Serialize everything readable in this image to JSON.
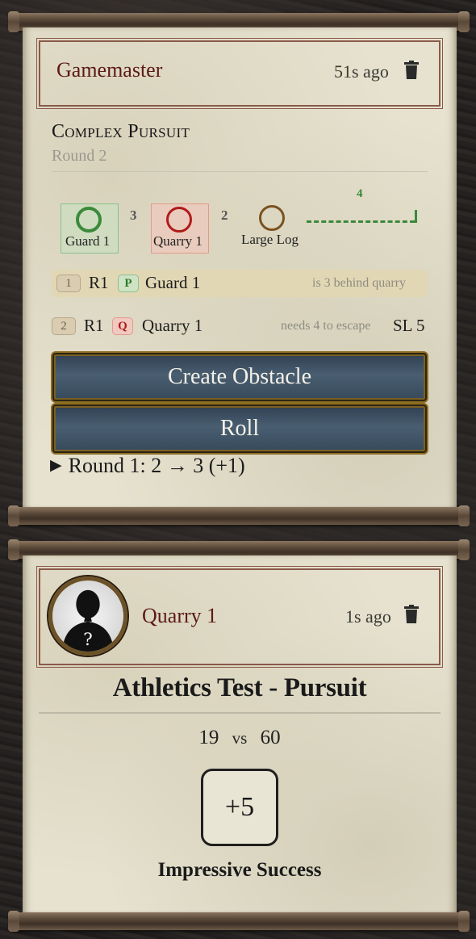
{
  "card1": {
    "speaker": "Gamemaster",
    "time_ago": "51s ago",
    "title": "Complex Pursuit",
    "round": "Round 2",
    "track": {
      "participants": [
        {
          "name": "Guard 1",
          "color": "#3a8a3a"
        },
        {
          "name": "Quarry 1",
          "color": "#b21a1a"
        },
        {
          "name": "Large Log",
          "color": "#7a5220"
        }
      ],
      "gaps": [
        "3",
        "2"
      ],
      "escape_distance": "4"
    },
    "rows": [
      {
        "index": "1",
        "round": "R1",
        "role": "P",
        "name": "Guard 1",
        "note": "is 3 behind quarry",
        "sl": ""
      },
      {
        "index": "2",
        "round": "R1",
        "role": "Q",
        "name": "Quarry 1",
        "note": "needs 4 to escape",
        "sl": "SL 5"
      }
    ],
    "create_obstacle_label": "Create Obstacle",
    "roll_label": "Roll",
    "history": "Round 1: 2 → 3 (+1)"
  },
  "card2": {
    "speaker": "Quarry 1",
    "time_ago": "1s ago",
    "test_title": "Athletics Test - Pursuit",
    "roll": "19",
    "vs_label": "vs",
    "target": "60",
    "sl": "+5",
    "result": "Impressive Success"
  },
  "colors": {
    "accent_blue": "#3b4f62",
    "name_red": "#5c1a16",
    "paper": "#e6e2cf"
  }
}
